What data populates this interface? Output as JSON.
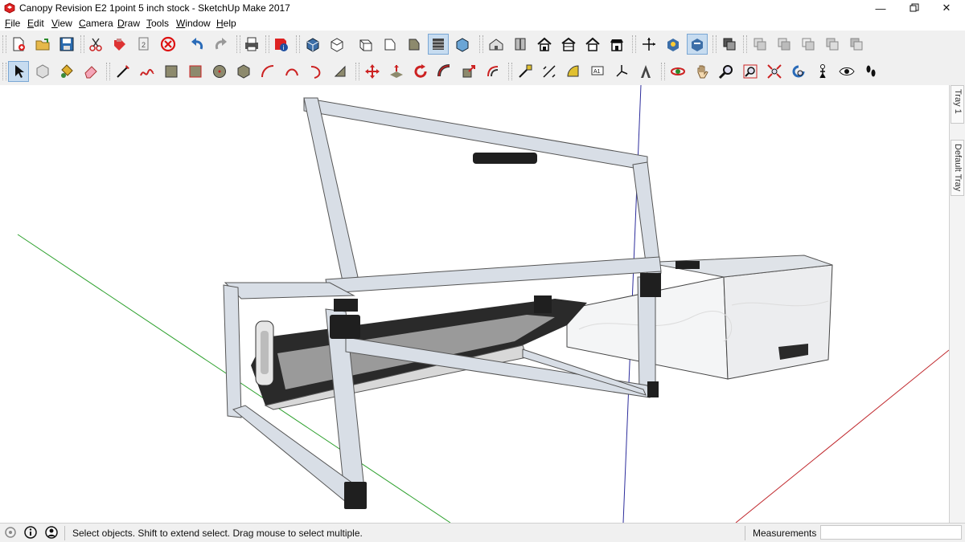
{
  "window": {
    "title": "Canopy Revision E2 1point 5 inch stock - SketchUp Make 2017",
    "minimize_icon": "minimize-icon",
    "restore_icon": "restore-icon",
    "close_icon": "close-icon"
  },
  "menu": [
    {
      "key": "F",
      "rest": "ile"
    },
    {
      "key": "E",
      "rest": "dit"
    },
    {
      "key": "V",
      "rest": "iew"
    },
    {
      "key": "C",
      "rest": "amera"
    },
    {
      "key": "D",
      "rest": "raw"
    },
    {
      "key": "T",
      "rest": "ools"
    },
    {
      "key": "W",
      "rest": "indow"
    },
    {
      "key": "H",
      "rest": "elp"
    }
  ],
  "toolbar1": [
    "new-file-icon",
    "open-file-icon",
    "save-icon",
    "cut-icon",
    "paste-icon",
    "copy-icon",
    "delete-icon",
    "undo-icon",
    "redo-icon",
    "print-icon",
    "model-info-icon",
    "iso-view-icon",
    "top-view-icon",
    "front-view-icon",
    "right-view-icon",
    "back-view-icon",
    "left-view-icon",
    "bottom-view-icon",
    "xray-icon",
    "wireframe-icon",
    "hidden-line-icon",
    "shaded-icon",
    "shaded-textures-icon",
    "monochrome-icon",
    "warehouse-icon",
    "extension-warehouse-icon",
    "house-icon",
    "house-styles-icon",
    "house-outline-icon",
    "house-roof-icon",
    "axes-icon",
    "section-plane-icon",
    "section-display-icon",
    "components-icon",
    "solid-union-icon",
    "solid-subtract-icon",
    "solid-intersect-icon",
    "solid-trim-icon",
    "solid-split-icon"
  ],
  "toolbar2": [
    "select-icon",
    "make-component-icon",
    "paint-bucket-icon",
    "eraser-icon",
    "line-icon",
    "freehand-icon",
    "rectangle-icon",
    "rotated-rectangle-icon",
    "circle-icon",
    "polygon-icon",
    "arc-icon",
    "two-point-arc-icon",
    "three-point-arc-icon",
    "pie-icon",
    "move-icon",
    "push-pull-icon",
    "rotate-icon",
    "follow-me-icon",
    "scale-icon",
    "offset-icon",
    "tape-measure-icon",
    "dimension-icon",
    "protractor-icon",
    "text-icon",
    "axes-tool-icon",
    "3d-text-icon",
    "orbit-icon",
    "pan-icon",
    "zoom-icon",
    "zoom-window-icon",
    "zoom-extents-icon",
    "previous-view-icon",
    "position-camera-icon",
    "look-around-icon",
    "walk-icon"
  ],
  "tray": {
    "tab1": "Tray 1",
    "tab2": "Default Tray"
  },
  "status": {
    "message": "Select objects. Shift to extend select. Drag mouse to select multiple.",
    "measurements_label": "Measurements",
    "measurements_value": ""
  },
  "colors": {
    "accent": "#c7dcf0",
    "axis_red": "#c0282d",
    "axis_green": "#2ca02c",
    "axis_blue": "#2d2d9c",
    "frame": "#d8dee6",
    "frame_dark": "#2a2a2a"
  }
}
